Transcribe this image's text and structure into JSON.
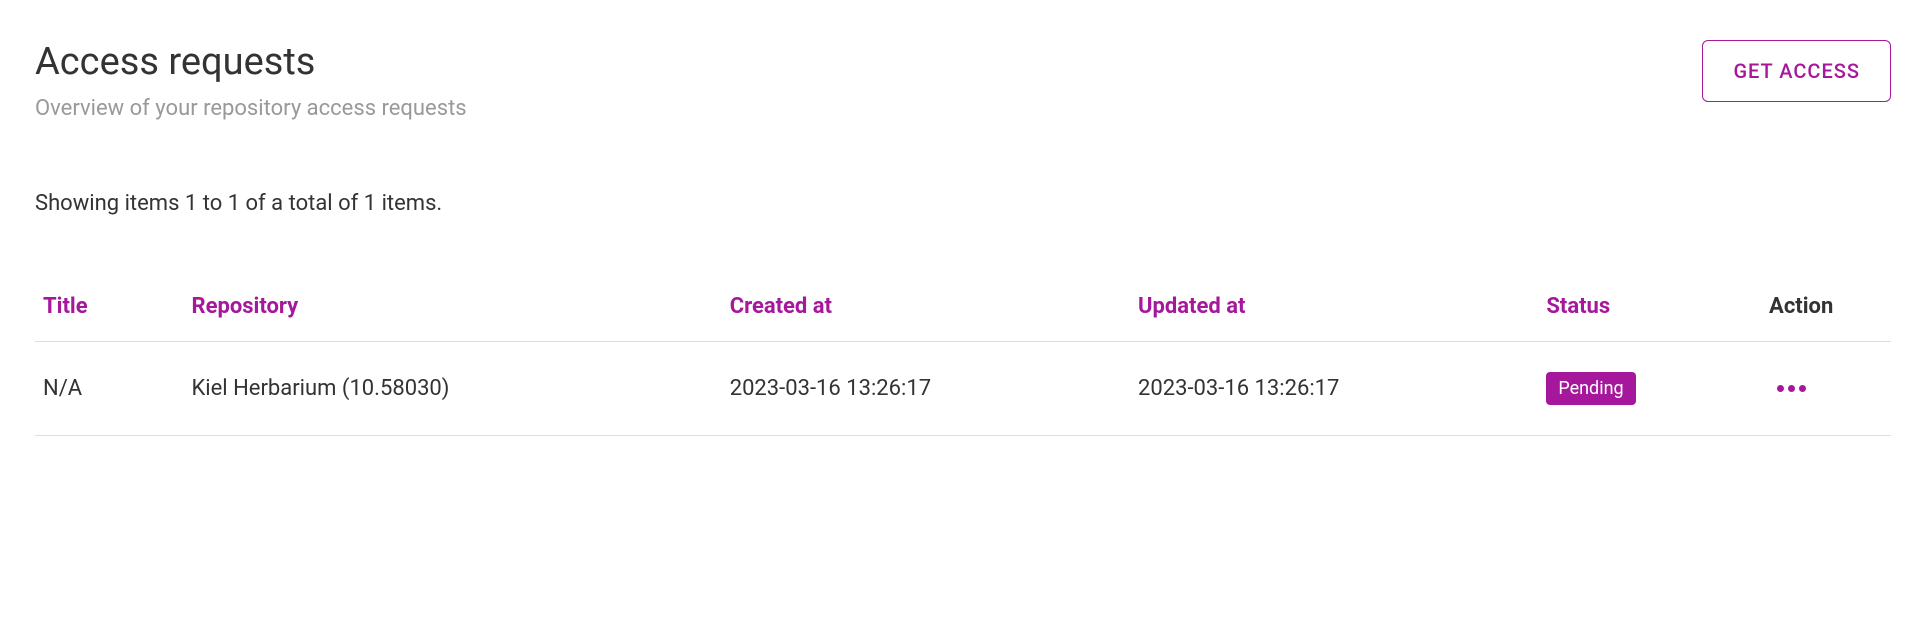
{
  "header": {
    "title": "Access requests",
    "subtitle": "Overview of your repository access requests",
    "get_access_label": "GET ACCESS"
  },
  "showing_text": "Showing items 1 to 1 of a total of 1 items.",
  "table": {
    "headers": {
      "title": "Title",
      "repository": "Repository",
      "created_at": "Created at",
      "updated_at": "Updated at",
      "status": "Status",
      "action": "Action"
    },
    "rows": [
      {
        "title": "N/A",
        "repository": "Kiel Herbarium (10.58030)",
        "created_at": "2023-03-16 13:26:17",
        "updated_at": "2023-03-16 13:26:17",
        "status": "Pending"
      }
    ]
  }
}
